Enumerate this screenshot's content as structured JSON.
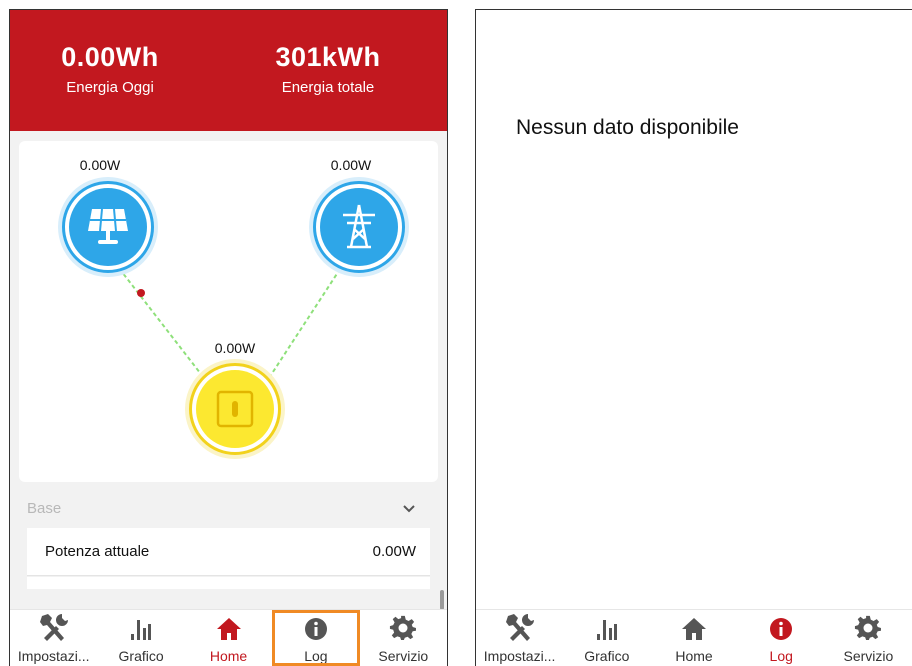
{
  "left": {
    "header": {
      "today_value": "0.00Wh",
      "today_label": "Energia Oggi",
      "total_value": "301kWh",
      "total_label": "Energia totale"
    },
    "flow": {
      "solar_power": "0.00W",
      "grid_power": "0.00W",
      "inverter_power": "0.00W"
    },
    "section": {
      "title": "Base"
    },
    "rows": [
      {
        "label": "Potenza attuale",
        "value": "0.00W"
      }
    ],
    "tabs": [
      {
        "label": "Impostazi...",
        "icon": "tools-icon",
        "active": false,
        "focused": false
      },
      {
        "label": "Grafico",
        "icon": "chart-icon",
        "active": false,
        "focused": false
      },
      {
        "label": "Home",
        "icon": "home-icon",
        "active": true,
        "focused": false
      },
      {
        "label": "Log",
        "icon": "info-icon",
        "active": false,
        "focused": true
      },
      {
        "label": "Servizio",
        "icon": "gear-icon",
        "active": false,
        "focused": false
      }
    ]
  },
  "right": {
    "message": "Nessun dato disponibile",
    "tabs": [
      {
        "label": "Impostazi...",
        "icon": "tools-icon",
        "active": false
      },
      {
        "label": "Grafico",
        "icon": "chart-icon",
        "active": false
      },
      {
        "label": "Home",
        "icon": "home-icon",
        "active": false
      },
      {
        "label": "Log",
        "icon": "info-icon",
        "active": true
      },
      {
        "label": "Servizio",
        "icon": "gear-icon",
        "active": false
      }
    ]
  },
  "colors": {
    "brand_red": "#c2181f",
    "solar_blue": "#2ea6e8",
    "inverter_yellow": "#fce830",
    "flow_line": "#8ee07a",
    "focus_orange": "#f08a24"
  }
}
